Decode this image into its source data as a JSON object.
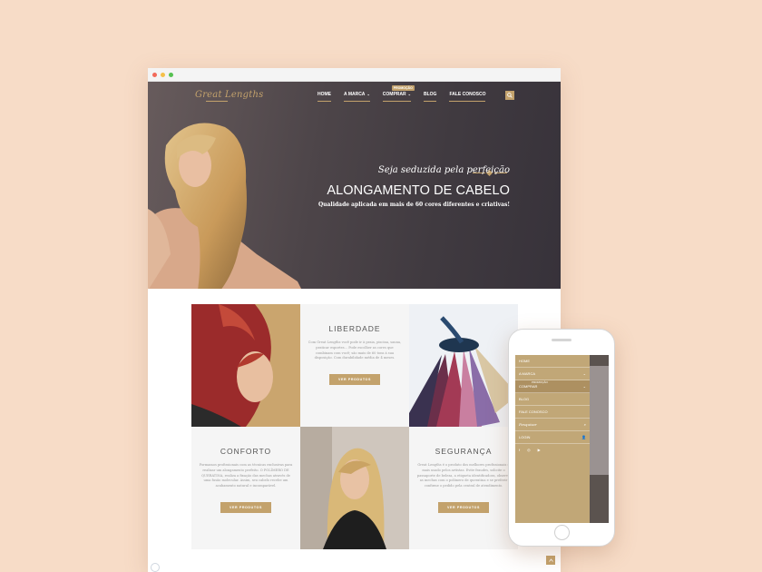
{
  "brand": {
    "logo": "Great Lengths",
    "gold": "#c3a26c"
  },
  "nav": {
    "items": [
      {
        "label": "HOME",
        "caret": ""
      },
      {
        "label": "A MARCA",
        "caret": "⌄"
      },
      {
        "label": "COMPRAR",
        "caret": "⌄",
        "badge": "PROMOÇÃO"
      },
      {
        "label": "BLOG",
        "caret": ""
      },
      {
        "label": "FALE CONOSCO",
        "caret": ""
      }
    ],
    "icon": "search-icon"
  },
  "hero": {
    "tagline": "Seja seduzida pela perfeição",
    "title": "ALONGAMENTO DE CABELO",
    "subtitle": "Qualidade aplicada em mais de 60 cores diferentes e criativas!"
  },
  "features": [
    {
      "title": "LIBERDADE",
      "text": "Com Great Lengths você pode ir à praia, piscina, sauna, praticar esportes... Pode escolher as cores que combinam com você; são mais de 60 tons à sua disposição. Com durabilidade média de 4 meses.",
      "button": "VER PRODUTOS"
    },
    {
      "title": "CONFORTO",
      "text": "Formamos profissionais com as técnicas exclusivas para realizar um alongamento perfeito. O POLÍMERO DE QUERATINA, realiza a fixação das mechas através de uma fusão molecular. Assim, seu cabelo recebe um acabamento natural e incomparável.",
      "button": "VER PRODUTOS"
    },
    {
      "title": "SEGURANÇA",
      "text": "Great Lengths é o produto dos melhores profissionais e mais usado pelos artistas. Evite fraudes, solicite o passaporte de beleza, a etiqueta identificadora, observe as mechas com o polímero de queratina e se preferir confirme o pedido pela central de atendimento.",
      "button": "VER PRODUTOS"
    }
  ],
  "mobile_menu": {
    "items": [
      {
        "label": "HOME",
        "right": ""
      },
      {
        "label": "A MARCA",
        "right": "⌄"
      },
      {
        "label": "COMPRAR",
        "right": "⌄",
        "badge": "PROMOÇÃO",
        "active": true
      },
      {
        "label": "BLOG",
        "right": ""
      },
      {
        "label": "FALE CONOSCO",
        "right": ""
      },
      {
        "label": "Pesquisar",
        "right": "⌕"
      },
      {
        "label": "LOGIN",
        "right": "👤"
      }
    ],
    "social": [
      "f",
      "◎",
      "▶"
    ]
  }
}
